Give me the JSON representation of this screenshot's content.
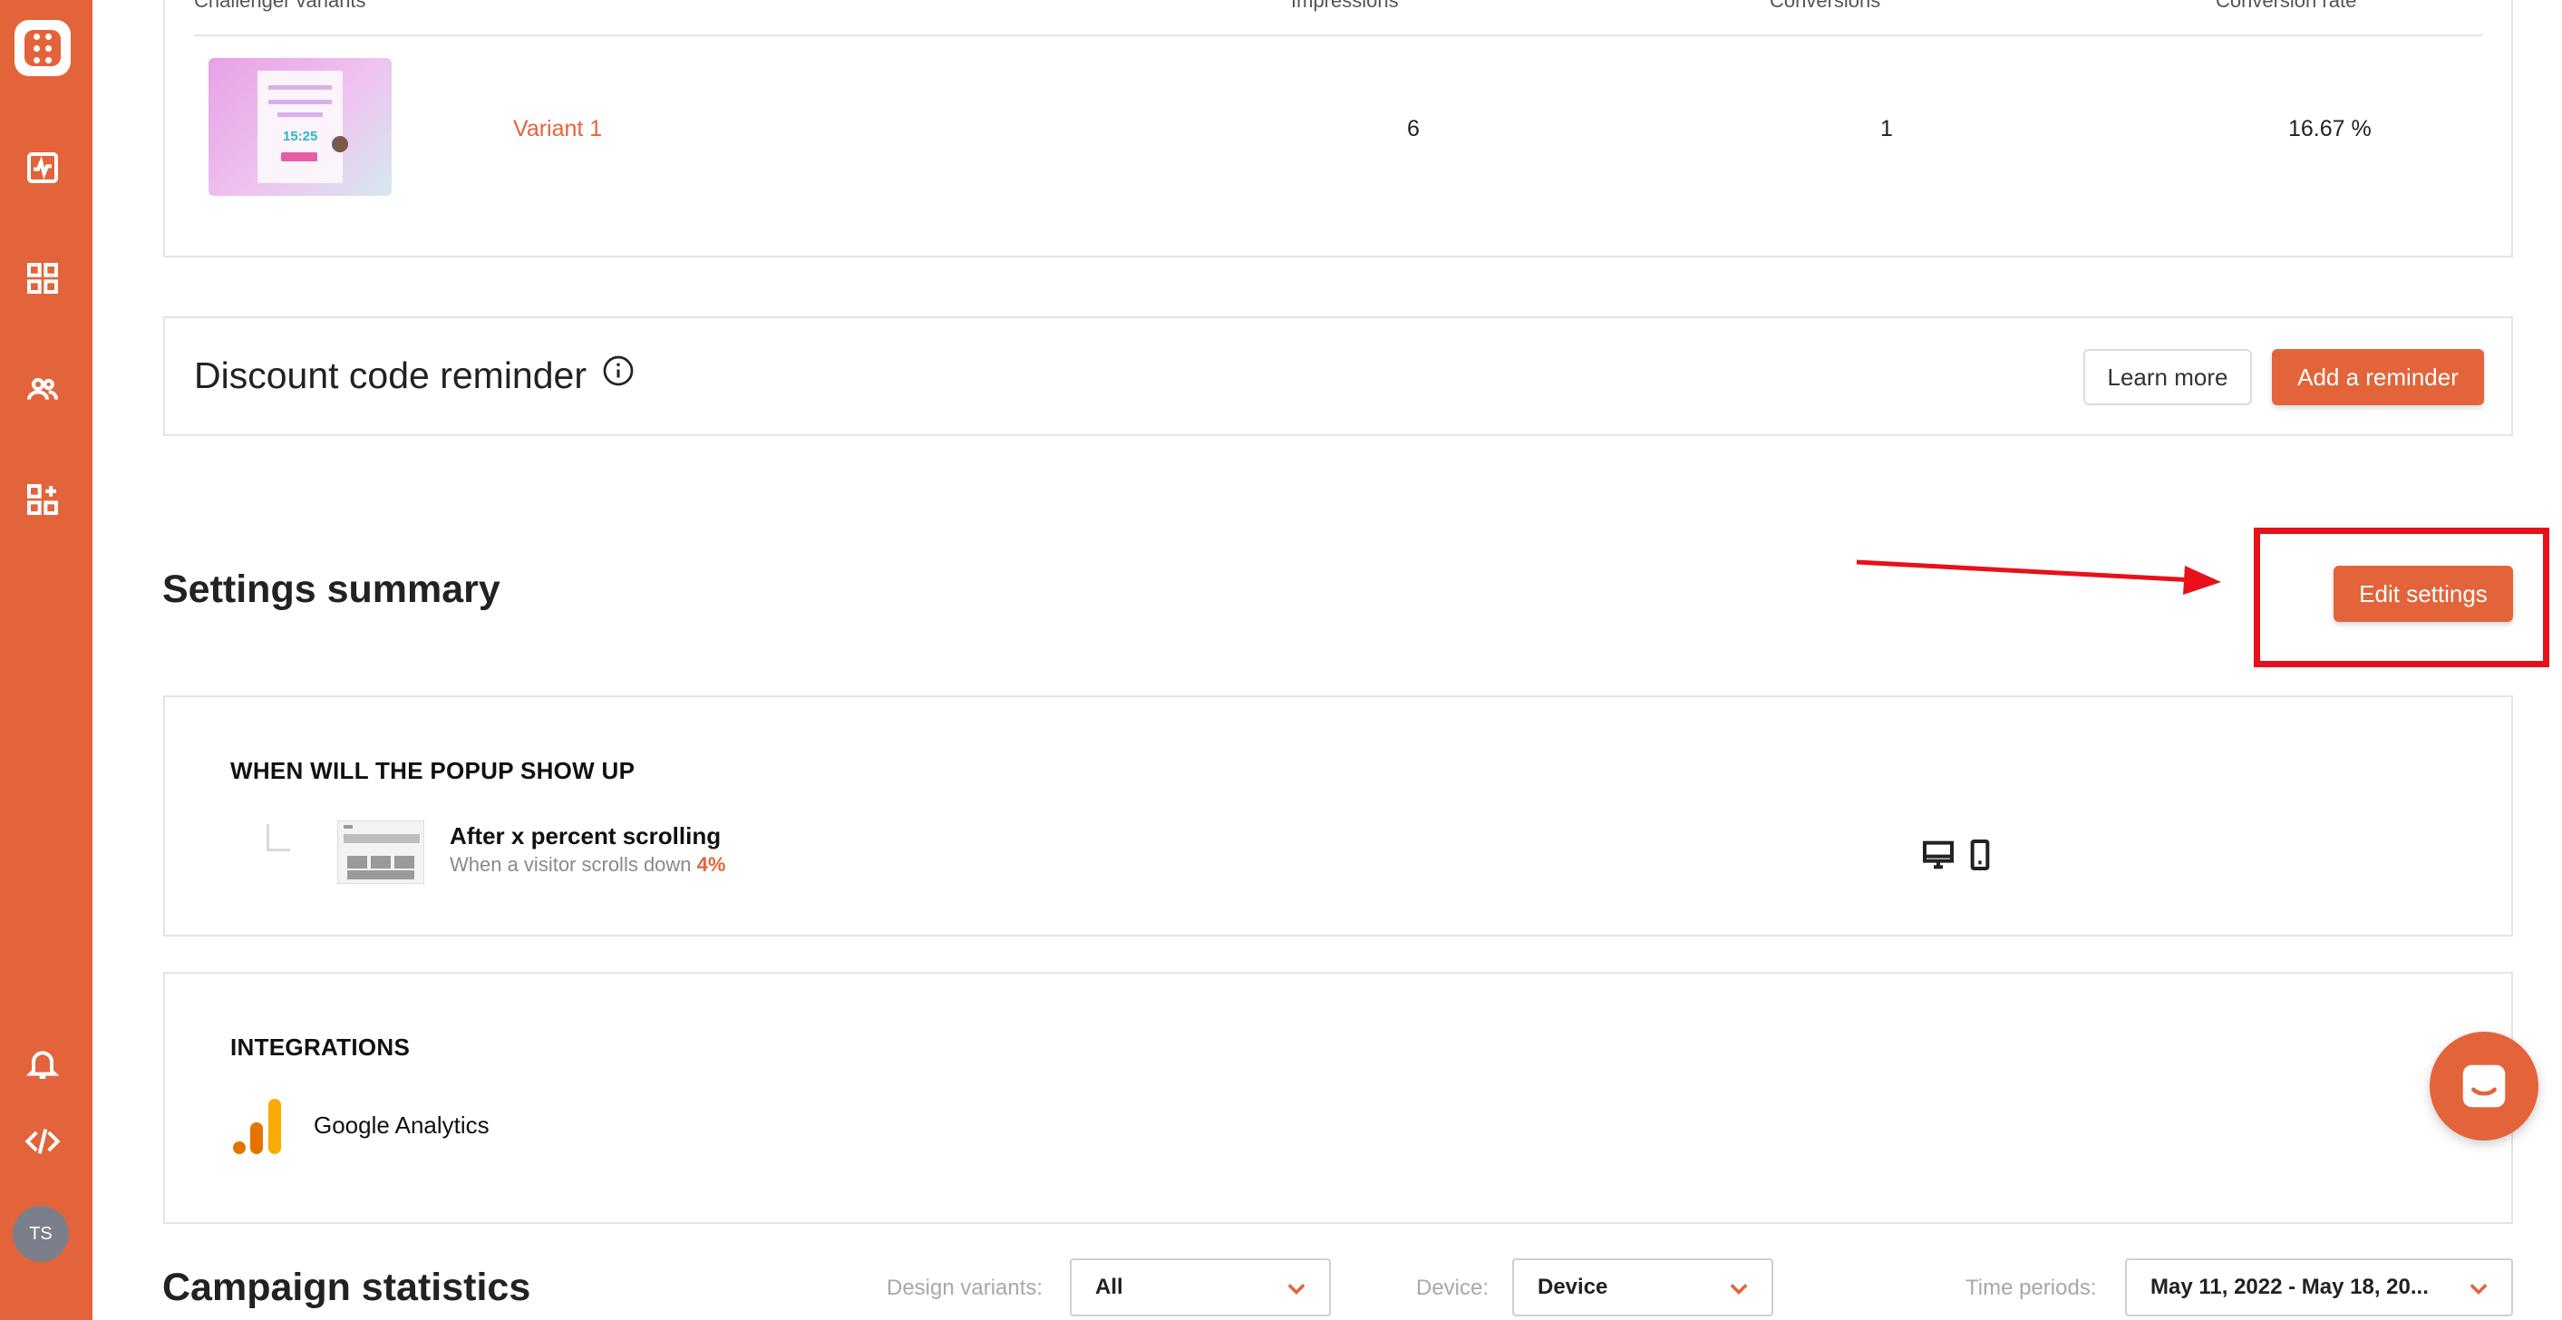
{
  "sidebar": {
    "user_initials": "TS"
  },
  "variants_table": {
    "headers": {
      "variant": "Challenger variants",
      "impressions": "Impressions",
      "conversions": "Conversions",
      "conversion_rate": "Conversion rate"
    },
    "thumbnail_timer": "15:25",
    "rows": [
      {
        "name": "Variant 1",
        "impressions": "6",
        "conversions": "1",
        "conversion_rate": "16.67 %"
      }
    ]
  },
  "discount_reminder": {
    "title": "Discount code reminder",
    "learn_more": "Learn more",
    "add_reminder": "Add a reminder"
  },
  "settings_summary": {
    "title": "Settings summary",
    "edit_button": "Edit settings",
    "when": {
      "heading": "WHEN WILL THE POPUP SHOW UP",
      "trigger_title": "After x percent scrolling",
      "trigger_desc": "When a visitor scrolls down",
      "trigger_value": "4%"
    },
    "integrations": {
      "heading": "INTEGRATIONS",
      "items": [
        "Google Analytics"
      ]
    }
  },
  "campaign_statistics": {
    "title": "Campaign statistics",
    "filters": {
      "design_variants_label": "Design variants:",
      "design_variants_value": "All",
      "device_label": "Device:",
      "device_value": "Device",
      "time_periods_label": "Time periods:",
      "time_periods_value": "May 11, 2022 - May 18, 20..."
    }
  },
  "colors": {
    "brand": "#e3643a",
    "annotation_red": "#e8101a"
  }
}
